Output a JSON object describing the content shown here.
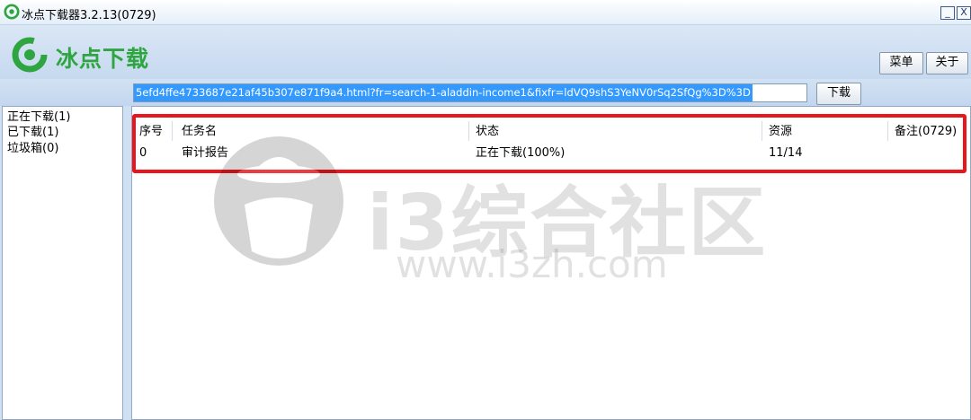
{
  "window": {
    "title": "冰点下载器3.2.13(0729)",
    "min_label": "_",
    "close_label": "X"
  },
  "header": {
    "logo_text": "冰点下载",
    "menu_label": "菜单",
    "about_label": "关于",
    "brand_color": "#2fa541"
  },
  "url_bar": {
    "value": "5efd4ffe4733687e21af45b307e871f9a4.html?fr=search-1-aladdin-income1&fixfr=ldVQ9shS3YeNV0rSq2SfQg%3D%3D",
    "download_label": "下载"
  },
  "sidebar": {
    "items": [
      {
        "label": "正在下载(1)"
      },
      {
        "label": "已下载(1)"
      },
      {
        "label": "垃圾箱(0)"
      }
    ]
  },
  "table": {
    "columns": [
      "序号",
      "任务名",
      "状态",
      "资源",
      "备注(0729)"
    ],
    "rows": [
      {
        "index": "0",
        "name": "审计报告",
        "status": "正在下载(100%)",
        "sources": "11/14",
        "note": ""
      }
    ],
    "highlight_color": "#e8161c"
  },
  "watermark": {
    "text": "i3综合社区",
    "url": "www.i3zh.com"
  }
}
